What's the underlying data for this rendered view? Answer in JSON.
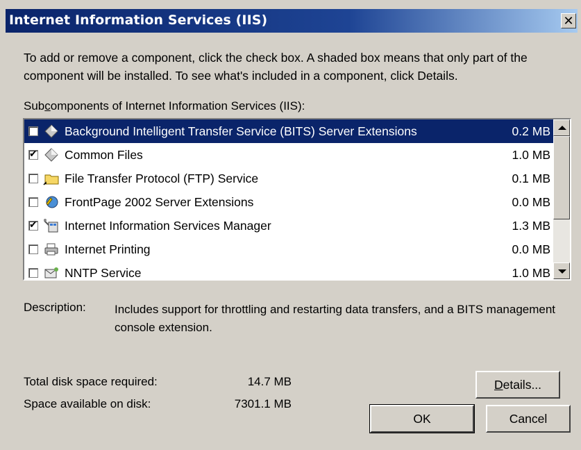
{
  "window": {
    "title": "Internet Information Services (IIS)",
    "close_glyph": "✕"
  },
  "instructions": "To add or remove a component, click the check box. A shaded box means that only part of the component will be installed. To see what's included in a component, click Details.",
  "subcomponents_label": {
    "before": "Sub",
    "underlined": "c",
    "after": "omponents of Internet Information Services (IIS):"
  },
  "components": [
    {
      "label": "Background Intelligent Transfer Service (BITS) Server Extensions",
      "size": "0.2 MB",
      "checked": false,
      "selected": true,
      "icon": "component-diamond-icon"
    },
    {
      "label": "Common Files",
      "size": "1.0 MB",
      "checked": true,
      "selected": false,
      "icon": "component-diamond-icon"
    },
    {
      "label": "File Transfer Protocol (FTP) Service",
      "size": "0.1 MB",
      "checked": false,
      "selected": false,
      "icon": "folder-icon"
    },
    {
      "label": "FrontPage 2002 Server Extensions",
      "size": "0.0 MB",
      "checked": false,
      "selected": false,
      "icon": "frontpage-icon"
    },
    {
      "label": "Internet Information Services Manager",
      "size": "1.3 MB",
      "checked": true,
      "selected": false,
      "icon": "iis-manager-icon"
    },
    {
      "label": "Internet Printing",
      "size": "0.0 MB",
      "checked": false,
      "selected": false,
      "icon": "printer-icon"
    },
    {
      "label": "NNTP Service",
      "size": "1.0 MB",
      "checked": false,
      "selected": false,
      "icon": "nntp-icon"
    }
  ],
  "description": {
    "label": "Description:",
    "text": "Includes support for throttling and restarting data transfers, and a BITS management console extension."
  },
  "disk": {
    "total_label": "Total disk space required:",
    "total_value": "14.7 MB",
    "available_label": "Space available on disk:",
    "available_value": "7301.1 MB"
  },
  "buttons": {
    "details": {
      "before": "",
      "underlined": "D",
      "after": "etails..."
    },
    "ok": "OK",
    "cancel": "Cancel"
  }
}
